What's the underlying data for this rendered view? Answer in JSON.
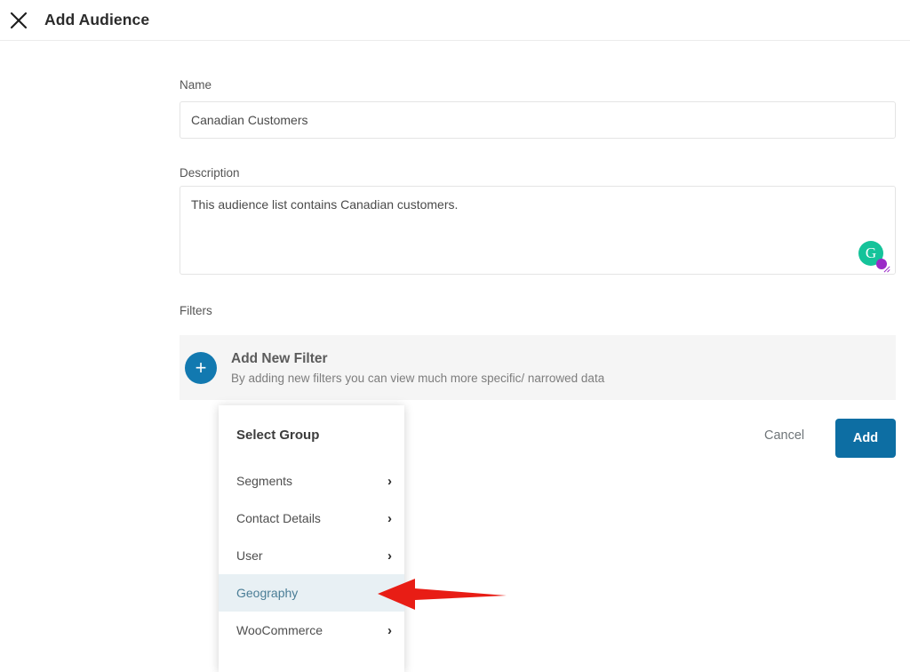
{
  "header": {
    "title": "Add Audience",
    "close_icon": "close-icon"
  },
  "form": {
    "name": {
      "label": "Name",
      "value": "Canadian Customers",
      "placeholder": "Name"
    },
    "description": {
      "label": "Description",
      "value": "This audience list contains Canadian customers.",
      "placeholder": "Description"
    },
    "filters": {
      "label": "Filters",
      "add_new_filter": {
        "icon": "plus-icon",
        "title": "Add New Filter",
        "subtitle": "By adding new filters you can view much more specific/ narrowed data"
      }
    }
  },
  "actions": {
    "cancel_label": "Cancel",
    "add_label": "Add"
  },
  "dropdown": {
    "title": "Select Group",
    "items": [
      {
        "label": "Segments",
        "chevron": "›",
        "active": false
      },
      {
        "label": "Contact Details",
        "chevron": "›",
        "active": false
      },
      {
        "label": "User",
        "chevron": "›",
        "active": false
      },
      {
        "label": "Geography",
        "chevron": "›",
        "active": true
      },
      {
        "label": "WooCommerce",
        "chevron": "›",
        "active": false
      }
    ]
  },
  "editor_badge": {
    "name": "grammarly-icon",
    "letter": "G"
  },
  "annotation": {
    "name": "red-arrow-pointing-to-geography",
    "color": "#e81d15"
  },
  "colors": {
    "primary_blue": "#0d6ea3",
    "plus_blue": "#1279b0",
    "filter_strip_bg": "#f5f5f5",
    "active_item_bg": "#e8f0f4",
    "active_item_text": "#4a7d96",
    "grammarly_green": "#15c39a",
    "grammarly_purple": "#9b29c7"
  }
}
